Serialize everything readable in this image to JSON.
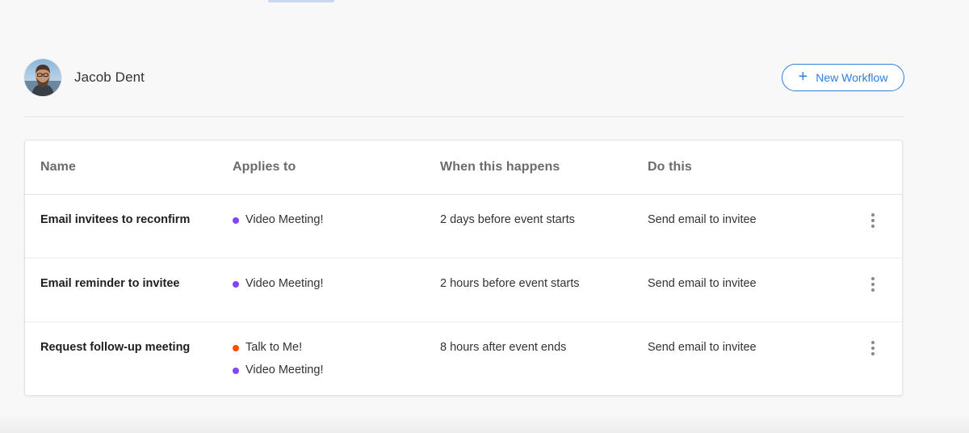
{
  "owner": {
    "name": "Jacob Dent"
  },
  "toolbar": {
    "new_workflow_label": "New Workflow",
    "new_workflow_icon": "plus-icon"
  },
  "table": {
    "columns": [
      "Name",
      "Applies to",
      "When this happens",
      "Do this"
    ],
    "rows": [
      {
        "name": "Email invitees to reconfirm",
        "applies_to": [
          {
            "label": "Video Meeting!",
            "color": "#8247f5"
          }
        ],
        "when": "2 days before event starts",
        "action": "Send email to invitee"
      },
      {
        "name": "Email reminder to invitee",
        "applies_to": [
          {
            "label": "Video Meeting!",
            "color": "#8247f5"
          }
        ],
        "when": "2 hours before event starts",
        "action": "Send email to invitee"
      },
      {
        "name": "Request follow-up meeting",
        "applies_to": [
          {
            "label": "Talk to Me!",
            "color": "#ff4f00"
          },
          {
            "label": "Video Meeting!",
            "color": "#8247f5"
          }
        ],
        "when": "8 hours after event ends",
        "action": "Send email to invitee"
      }
    ]
  },
  "colors": {
    "accent": "#2f7de1",
    "purple_event": "#8247f5",
    "orange_event": "#ff4f00"
  }
}
